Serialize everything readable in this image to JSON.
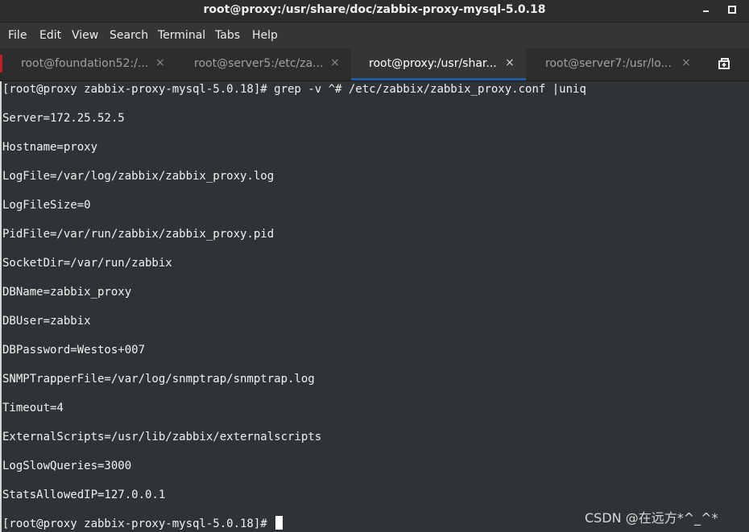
{
  "window": {
    "title": "root@proxy:/usr/share/doc/zabbix-proxy-mysql-5.0.18",
    "minimize_icon": "minimize-icon",
    "maximize_icon": "maximize-icon"
  },
  "menu": {
    "items": [
      "File",
      "Edit",
      "View",
      "Search",
      "Terminal",
      "Tabs",
      "Help"
    ]
  },
  "tabs": [
    {
      "label": "root@foundation52:/...",
      "active": false
    },
    {
      "label": "root@server5:/etc/za...",
      "active": false
    },
    {
      "label": "root@proxy:/usr/shar...",
      "active": true
    },
    {
      "label": "root@server7:/usr/lo...",
      "active": false
    }
  ],
  "tab_close_glyph": "×",
  "new_tab_icon": "new-tab-icon",
  "terminal": {
    "command_line": "[root@proxy zabbix-proxy-mysql-5.0.18]# grep -v ^# /etc/zabbix/zabbix_proxy.conf |uniq",
    "output": [
      "Server=172.25.52.5",
      "Hostname=proxy",
      "LogFile=/var/log/zabbix/zabbix_proxy.log",
      "LogFileSize=0",
      "PidFile=/var/run/zabbix/zabbix_proxy.pid",
      "SocketDir=/var/run/zabbix",
      "DBName=zabbix_proxy",
      "DBUser=zabbix",
      "DBPassword=Westos+007",
      "SNMPTrapperFile=/var/log/snmptrap/snmptrap.log",
      "Timeout=4",
      "ExternalScripts=/usr/lib/zabbix/externalscripts",
      "LogSlowQueries=3000",
      "StatsAllowedIP=127.0.0.1"
    ],
    "prompt": "[root@proxy zabbix-proxy-mysql-5.0.18]# "
  },
  "watermark": "CSDN @在远方*^_^*",
  "colors": {
    "terminal_bg": "#2e3436",
    "header_bg": "#2d2d2d",
    "active_tab_underline": "#215d9c"
  }
}
